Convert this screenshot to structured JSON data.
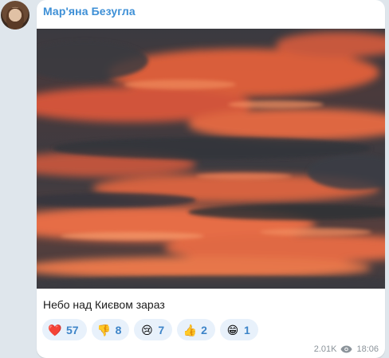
{
  "post": {
    "sender_name": "Мар'яна Безугла",
    "caption": "Небо над Києвом зараз",
    "views": "2.01K",
    "time": "18:06"
  },
  "reactions": [
    {
      "emoji": "❤️",
      "icon": "heart-icon",
      "count": "57"
    },
    {
      "emoji": "👎",
      "icon": "thumbs-down-icon",
      "count": "8"
    },
    {
      "emoji": "😢",
      "icon": "crying-face-icon",
      "count": "7"
    },
    {
      "emoji": "👍",
      "icon": "thumbs-up-icon",
      "count": "2"
    },
    {
      "emoji": "😁",
      "icon": "grinning-face-icon",
      "count": "1"
    }
  ],
  "colors": {
    "accent": "#3d8fd6",
    "reaction_bg": "#e8f1fb",
    "sky_orange": "#e8643e",
    "sky_dark": "#2f3136"
  }
}
